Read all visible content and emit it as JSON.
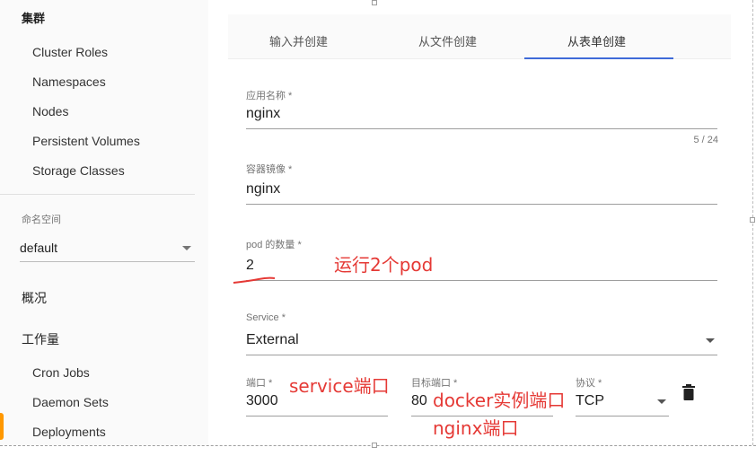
{
  "sidebar": {
    "cluster_header": "集群",
    "cluster_items": [
      "Cluster Roles",
      "Namespaces",
      "Nodes",
      "Persistent Volumes",
      "Storage Classes"
    ],
    "namespace_label": "命名空间",
    "namespace_value": "default",
    "overview": "概况",
    "workloads": "工作量",
    "workload_items": [
      "Cron Jobs",
      "Daemon Sets",
      "Deployments"
    ]
  },
  "tabs": [
    "输入并创建",
    "从文件创建",
    "从表单创建"
  ],
  "active_tab_index": 2,
  "form": {
    "app_name": {
      "label": "应用名称 *",
      "value": "nginx",
      "counter": "5 / 24"
    },
    "container_image": {
      "label": "容器镜像 *",
      "value": "nginx"
    },
    "pod_count": {
      "label": "pod 的数量 *",
      "value": "2"
    },
    "service": {
      "label": "Service *",
      "value": "External"
    },
    "port": {
      "label": "端口 *",
      "value": "3000"
    },
    "target_port": {
      "label": "目标端口 *",
      "value": "80"
    },
    "protocol": {
      "label": "协议 *",
      "value": "TCP"
    }
  },
  "annotations": {
    "pods": "运行2个pod",
    "service_port": "service端口",
    "docker_port": "docker实例端口",
    "nginx_port": "nginx端口"
  },
  "colors": {
    "accent": "#3f6ad8",
    "annotation": "#e53935",
    "sidebar_marker": "#ff9800"
  }
}
